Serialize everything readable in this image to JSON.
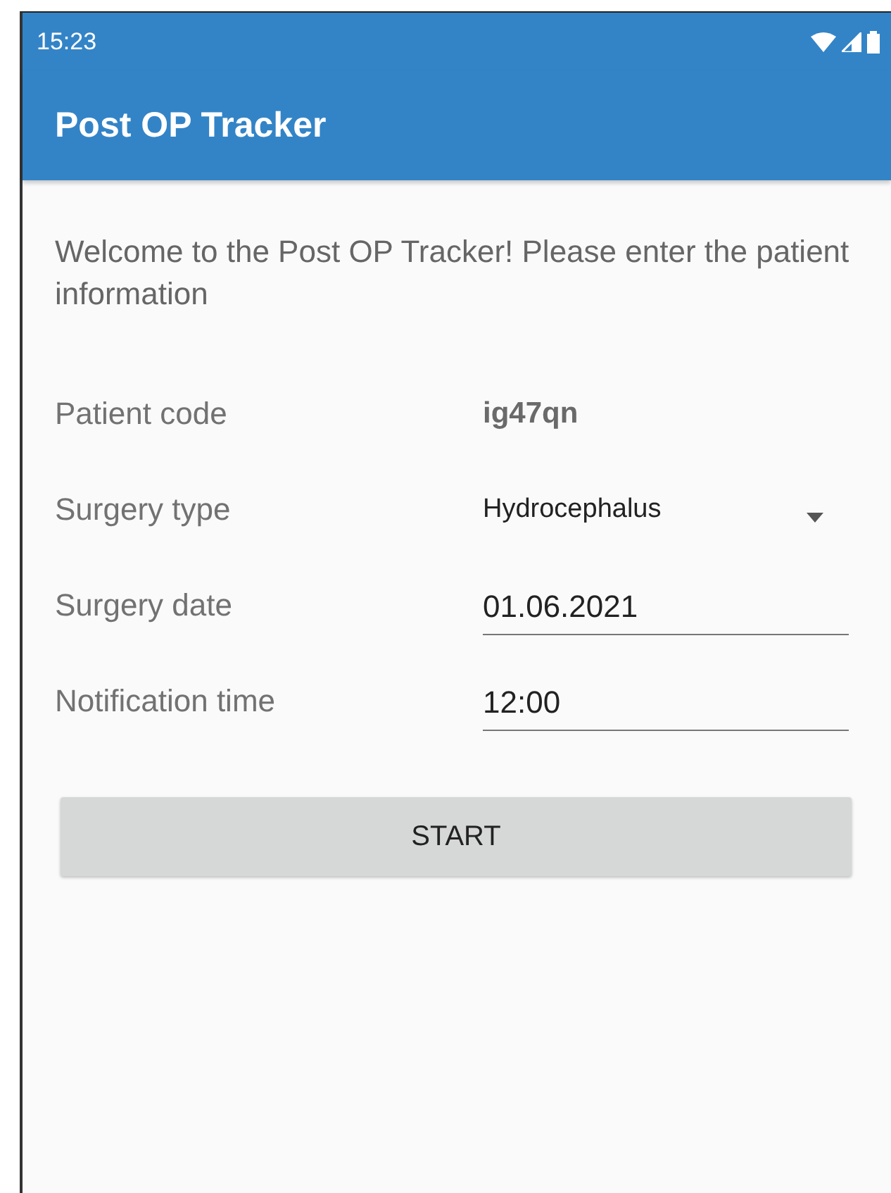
{
  "status_bar": {
    "time": "15:23"
  },
  "app_bar": {
    "title": "Post OP Tracker"
  },
  "intro": "Welcome to the Post OP Tracker! Please enter the patient information",
  "fields": [
    {
      "kind": "text",
      "label": "Patient code",
      "value": "ig47qn"
    },
    {
      "kind": "dropdown",
      "label": "Surgery type",
      "value": "Hydrocephalus"
    },
    {
      "kind": "input",
      "label": "Surgery date",
      "value": "01.06.2021"
    },
    {
      "kind": "input",
      "label": "Notification time",
      "value": "12:00"
    }
  ],
  "button": {
    "label": "START"
  }
}
